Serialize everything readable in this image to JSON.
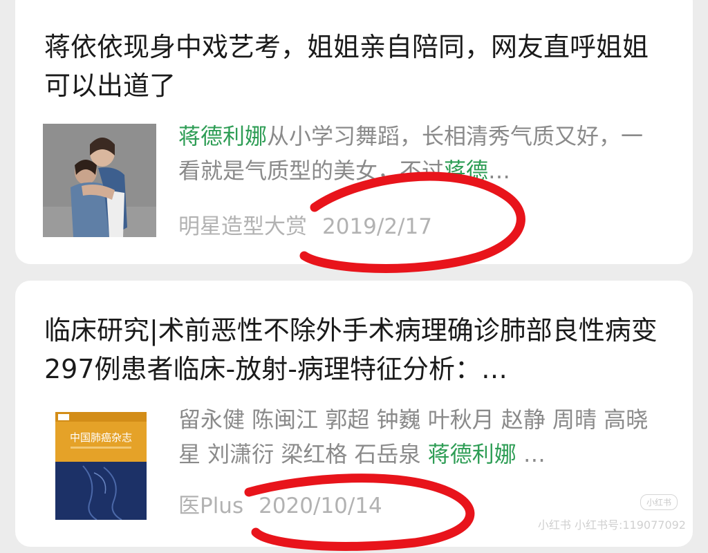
{
  "results": [
    {
      "title": "蒋依依现身中戏艺考，姐姐亲自陪同，网友直呼姐姐可以出道了",
      "snippet_highlight_1": "蒋德利娜",
      "snippet_text": "从小学习舞蹈，长相清秀气质又好，一看就是气质型的美女，不过",
      "snippet_highlight_2": "蒋德",
      "ellipsis": "…",
      "source": "明星造型大赏",
      "date": "2019/2/17"
    },
    {
      "title": "临床研究|术前恶性不除外手术病理确诊肺部良性病变297例患者临床-放射-病理特征分析：…",
      "authors": "留永健 陈闽江 郭超 钟巍 叶秋月 赵静 周晴 高晓星 刘潇衍 梁红格 石岳泉 ",
      "snippet_highlight": "蒋德利娜",
      "ellipsis": " …",
      "source": "医Plus",
      "date": "2020/10/14",
      "cover_title": "中国肺癌杂志"
    }
  ],
  "watermark": {
    "badge": "小红书",
    "text": "小红书 小红书号:119077092"
  },
  "colors": {
    "highlight": "#2e9d55",
    "annotation": "#e8141b"
  }
}
